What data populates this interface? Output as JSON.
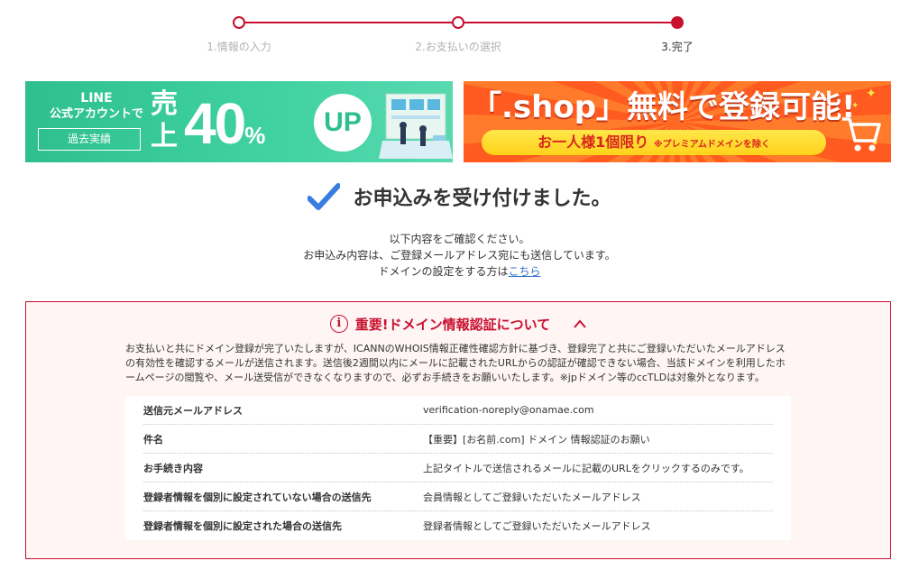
{
  "stepper": {
    "steps": [
      {
        "label": "1.情報の入力",
        "state": "done"
      },
      {
        "label": "2.お支払いの選択",
        "state": "done"
      },
      {
        "label": "3.完了",
        "state": "current"
      }
    ],
    "accent_color": "#c8102e"
  },
  "banners": {
    "line": {
      "line1": "LINE",
      "line2": "公式アカウントで",
      "record": "過去実績",
      "sale": "売上",
      "percent": "40",
      "percent_unit": "%",
      "up": "UP"
    },
    "shop": {
      "headline": "「.shop」無料で登録可能!",
      "pill_main": "お一人様1個限り",
      "pill_note": "※プレミアムドメインを除く"
    }
  },
  "confirmation": {
    "title": "お申込みを受け付けました。",
    "line1": "以下内容をご確認ください。",
    "line2": "お申込み内容は、ご登録メールアドレス宛にも送信しています。",
    "line3_prefix": "ドメインの設定をする方は",
    "line3_link": "こちら"
  },
  "notice": {
    "title": "重要!ドメイン情報認証について",
    "info_icon": "i",
    "body": "お支払いと共にドメイン登録が完了いたしますが、ICANNのWHOIS情報正確性確認方針に基づき、登録完了と共にご登録いただいたメールアドレスの有効性を確認するメールが送信されます。送信後2週間以内にメールに記載されたURLからの認証が確認できない場合、当該ドメインを利用したホームページの閲覧や、メール送受信ができなくなりますので、必ずお手続きをお願いいたします。※jpドメイン等のccTLDは対象外となります。",
    "rows": [
      {
        "key": "送信元メールアドレス",
        "value": "verification-noreply@onamae.com"
      },
      {
        "key": "件名",
        "value": "【重要】[お名前.com] ドメイン 情報認証のお願い"
      },
      {
        "key": "お手続き内容",
        "value": "上記タイトルで送信されるメールに記載のURLをクリックするのみです。"
      },
      {
        "key": "登録者情報を個別に設定されていない場合の送信先",
        "value": "会員情報としてご登録いただいたメールアドレス"
      },
      {
        "key": "登録者情報を個別に設定された場合の送信先",
        "value": "登録者情報としてご登録いただいたメールアドレス"
      }
    ]
  }
}
